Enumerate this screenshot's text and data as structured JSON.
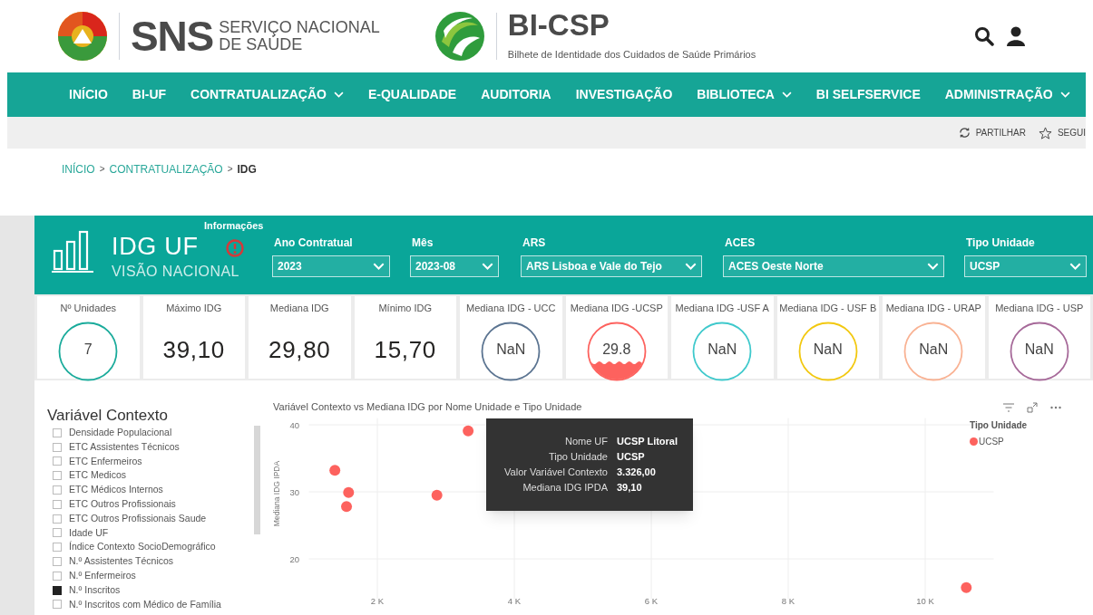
{
  "header": {
    "sns_title": "SNS",
    "sns_subtitle_lines": [
      "SERVIÇO NACIONAL",
      "DE SAÚDE"
    ],
    "app_title": "BI-CSP",
    "app_subtitle": "Bilhete de Identidade dos Cuidados de Saúde Primários"
  },
  "nav": [
    {
      "label": "INÍCIO",
      "has_menu": false
    },
    {
      "label": "BI-UF",
      "has_menu": false
    },
    {
      "label": "CONTRATUALIZAÇÃO",
      "has_menu": true
    },
    {
      "label": "E-QUALIDADE",
      "has_menu": false
    },
    {
      "label": "AUDITORIA",
      "has_menu": false
    },
    {
      "label": "INVESTIGAÇÃO",
      "has_menu": false
    },
    {
      "label": "BIBLIOTECA",
      "has_menu": true
    },
    {
      "label": "BI SELFSERVICE",
      "has_menu": false
    },
    {
      "label": "ADMINISTRAÇÃO",
      "has_menu": true
    }
  ],
  "actions": [
    {
      "kind": "share",
      "label": "PARTILHAR"
    },
    {
      "kind": "follow",
      "label": "SEGUI"
    }
  ],
  "breadcrumb": {
    "separator": ">",
    "items": [
      {
        "label": "INÍCIO",
        "current": false
      },
      {
        "label": "CONTRATUALIZAÇÃO",
        "current": false
      },
      {
        "label": "IDG",
        "current": true
      }
    ]
  },
  "report": {
    "title": "IDG UF",
    "subtitle": "VISÃO NACIONAL",
    "info_label": "Informações",
    "filters": [
      {
        "label": "Ano Contratual",
        "value": "2023"
      },
      {
        "label": "Mês",
        "value": "2023-08"
      },
      {
        "label": "ARS",
        "value": "ARS Lisboa e Vale do Tejo"
      },
      {
        "label": "ACES",
        "value": "ACES Oeste Norte"
      },
      {
        "label": "Tipo Unidade",
        "value": "UCSP"
      }
    ],
    "cards": [
      {
        "label": "Nº Unidades",
        "kind": "circle",
        "value": "7",
        "color": "#1aab9b"
      },
      {
        "label": "Máximo IDG",
        "kind": "number",
        "value": "39,10"
      },
      {
        "label": "Mediana IDG",
        "kind": "number",
        "value": "29,80"
      },
      {
        "label": "Mínimo IDG",
        "kind": "number",
        "value": "15,70"
      },
      {
        "label": "Mediana IDG - UCC",
        "kind": "circle",
        "value": "NaN",
        "color": "#5b7491"
      },
      {
        "label": "Mediana IDG -UCSP",
        "kind": "liquid",
        "value": "29.8",
        "color": "#fd625e"
      },
      {
        "label": "Mediana IDG -USF A",
        "kind": "circle",
        "value": "NaN",
        "color": "#3fc9cc"
      },
      {
        "label": "Mediana IDG - USF B",
        "kind": "circle",
        "value": "NaN",
        "color": "#f2c80f"
      },
      {
        "label": "Mediana IDG - URAP",
        "kind": "circle",
        "value": "NaN",
        "color": "#f9b293"
      },
      {
        "label": "Mediana IDG - USP",
        "kind": "circle",
        "value": "NaN",
        "color": "#a66999"
      }
    ],
    "slicer": {
      "title": "Variável Contexto",
      "items": [
        {
          "label": "Densidade Populacional",
          "checked": false
        },
        {
          "label": "ETC Assistentes Técnicos",
          "checked": false
        },
        {
          "label": "ETC Enfermeiros",
          "checked": false
        },
        {
          "label": "ETC Medicos",
          "checked": false
        },
        {
          "label": "ETC Médicos Internos",
          "checked": false
        },
        {
          "label": "ETC Outros Profissionais",
          "checked": false
        },
        {
          "label": "ETC Outros Profissionais Saude",
          "checked": false
        },
        {
          "label": "Idade UF",
          "checked": false
        },
        {
          "label": "Índice Contexto SocioDemográfico",
          "checked": false
        },
        {
          "label": "N.º Assistentes Técnicos",
          "checked": false
        },
        {
          "label": "N.º Enfermeiros",
          "checked": false
        },
        {
          "label": "N.º Inscritos",
          "checked": true
        },
        {
          "label": "N.º Inscritos com Médico de Família",
          "checked": false
        }
      ]
    },
    "scatter": {
      "legend_title": "Tipo Unidade",
      "tooltip": [
        {
          "label": "Nome UF",
          "value": "UCSP Litoral"
        },
        {
          "label": "Tipo Unidade",
          "value": "UCSP"
        },
        {
          "label": "Valor Variável Contexto",
          "value": "3.326,00"
        },
        {
          "label": "Mediana IDG IPDA",
          "value": "39,10"
        }
      ],
      "chart_data": {
        "type": "scatter",
        "title": "Variável Contexto vs Mediana IDG por Nome Unidade e Tipo Unidade",
        "ylabel": "Mediana IDG IPDA",
        "x": [
          1380,
          1550,
          1580,
          2870,
          3326,
          10600
        ],
        "series": [
          {
            "name": "UCSP",
            "color": "#fd625e",
            "values": [
              33.2,
              27.8,
              29.9,
              29.5,
              39.1,
              15.7
            ]
          }
        ],
        "xlim": [
          1000,
          11000
        ],
        "ylim": [
          14,
          41
        ],
        "xticks": [
          {
            "value": 2000,
            "label": "2 K"
          },
          {
            "value": 4000,
            "label": "4 K"
          },
          {
            "value": 6000,
            "label": "6 K"
          },
          {
            "value": 8000,
            "label": "8 K"
          },
          {
            "value": 10000,
            "label": "10 K"
          }
        ],
        "yticks": [
          20,
          30,
          40
        ],
        "grid": true
      }
    }
  }
}
